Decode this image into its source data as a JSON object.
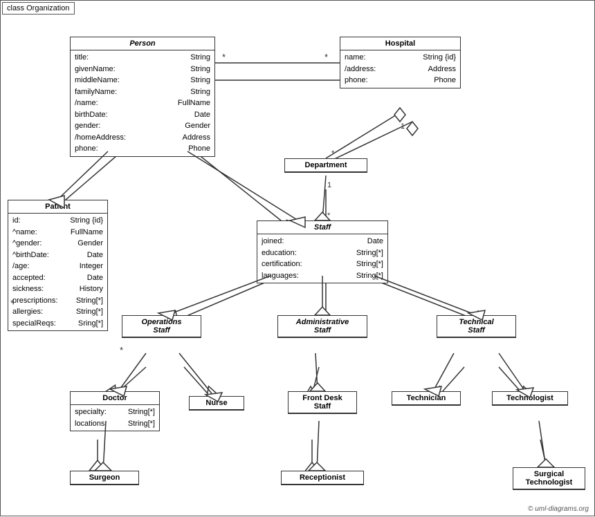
{
  "diagram": {
    "title": "class Organization",
    "copyright": "© uml-diagrams.org",
    "classes": {
      "person": {
        "name": "Person",
        "italic": true,
        "attrs": [
          {
            "name": "title:",
            "type": "String"
          },
          {
            "name": "givenName:",
            "type": "String"
          },
          {
            "name": "middleName:",
            "type": "String"
          },
          {
            "name": "familyName:",
            "type": "String"
          },
          {
            "name": "/name:",
            "type": "FullName"
          },
          {
            "name": "birthDate:",
            "type": "Date"
          },
          {
            "name": "gender:",
            "type": "Gender"
          },
          {
            "name": "/homeAddress:",
            "type": "Address"
          },
          {
            "name": "phone:",
            "type": "Phone"
          }
        ]
      },
      "hospital": {
        "name": "Hospital",
        "italic": false,
        "attrs": [
          {
            "name": "name:",
            "type": "String {id}"
          },
          {
            "name": "/address:",
            "type": "Address"
          },
          {
            "name": "phone:",
            "type": "Phone"
          }
        ]
      },
      "department": {
        "name": "Department",
        "italic": false,
        "attrs": []
      },
      "staff": {
        "name": "Staff",
        "italic": true,
        "attrs": [
          {
            "name": "joined:",
            "type": "Date"
          },
          {
            "name": "education:",
            "type": "String[*]"
          },
          {
            "name": "certification:",
            "type": "String[*]"
          },
          {
            "name": "languages:",
            "type": "String[*]"
          }
        ]
      },
      "patient": {
        "name": "Patient",
        "italic": false,
        "attrs": [
          {
            "name": "id:",
            "type": "String {id}"
          },
          {
            "name": "^name:",
            "type": "FullName"
          },
          {
            "name": "^gender:",
            "type": "Gender"
          },
          {
            "name": "^birthDate:",
            "type": "Date"
          },
          {
            "name": "/age:",
            "type": "Integer"
          },
          {
            "name": "accepted:",
            "type": "Date"
          },
          {
            "name": "sickness:",
            "type": "History"
          },
          {
            "name": "prescriptions:",
            "type": "String[*]"
          },
          {
            "name": "allergies:",
            "type": "String[*]"
          },
          {
            "name": "specialReqs:",
            "type": "Sring[*]"
          }
        ]
      },
      "operationsStaff": {
        "name": "Operations\nStaff",
        "italic": true,
        "attrs": []
      },
      "administrativeStaff": {
        "name": "Administrative\nStaff",
        "italic": true,
        "attrs": []
      },
      "technicalStaff": {
        "name": "Technical\nStaff",
        "italic": true,
        "attrs": []
      },
      "doctor": {
        "name": "Doctor",
        "italic": false,
        "attrs": [
          {
            "name": "specialty:",
            "type": "String[*]"
          },
          {
            "name": "locations:",
            "type": "String[*]"
          }
        ]
      },
      "nurse": {
        "name": "Nurse",
        "italic": false,
        "attrs": []
      },
      "frontDeskStaff": {
        "name": "Front Desk\nStaff",
        "italic": false,
        "attrs": []
      },
      "technician": {
        "name": "Technician",
        "italic": false,
        "attrs": []
      },
      "technologist": {
        "name": "Technologist",
        "italic": false,
        "attrs": []
      },
      "surgeon": {
        "name": "Surgeon",
        "italic": false,
        "attrs": []
      },
      "receptionist": {
        "name": "Receptionist",
        "italic": false,
        "attrs": []
      },
      "surgicalTechnologist": {
        "name": "Surgical\nTechnologist",
        "italic": false,
        "attrs": []
      }
    }
  }
}
